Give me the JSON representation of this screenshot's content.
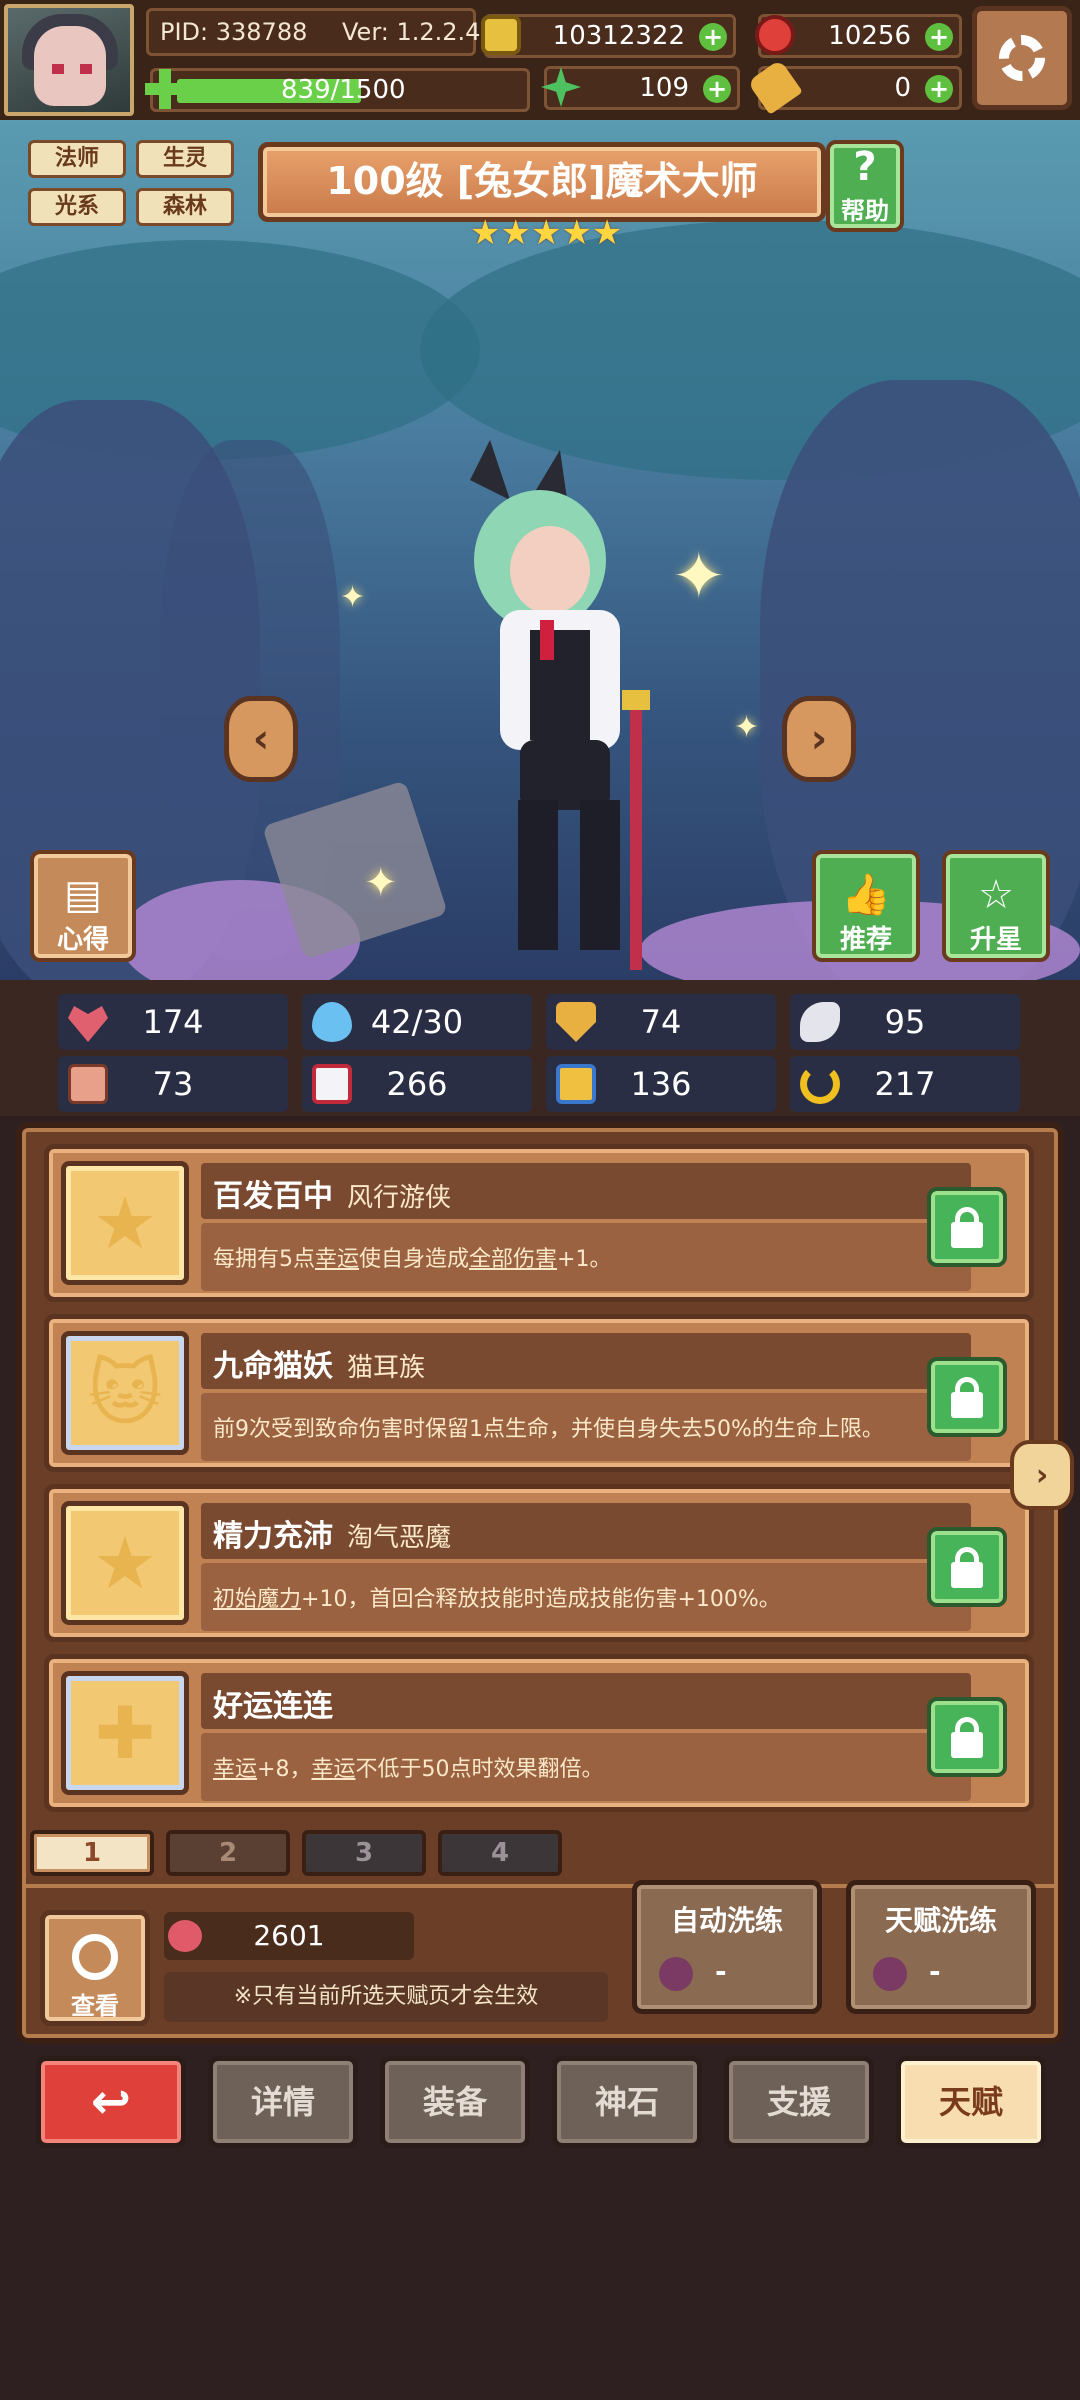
{
  "header": {
    "pid": "PID: 338788",
    "version": "Ver: 1.2.2.4",
    "gold": "10312322",
    "gems": "10256",
    "exp_text": "839/1500",
    "exp_fraction": 0.559,
    "clover": "109",
    "key": "0",
    "settings_icon": "gear-icon"
  },
  "tags": [
    "法师",
    "生灵",
    "光系",
    "森林"
  ],
  "hero": {
    "title": "100级 [兔女郎]魔术大师",
    "stars": "★★★★★",
    "star_count": 5,
    "help_label": "帮助",
    "notes_label": "心得",
    "recommend_label": "推荐",
    "upgrade_label": "升星"
  },
  "stats": {
    "hp": "174",
    "mana": "42/30",
    "defense": "74",
    "speed": "95",
    "attack": "73",
    "magic": "266",
    "skill": "136",
    "luck": "217"
  },
  "talents": [
    {
      "name": "百发百中",
      "source": "风行游侠",
      "desc_parts": [
        "每拥有5点",
        "幸运",
        "使自身造成",
        "全部伤害",
        "+1。"
      ]
    },
    {
      "name": "九命猫妖",
      "source": "猫耳族",
      "desc": "前9次受到致命伤害时保留1点生命，并使自身失去50%的生命上限。"
    },
    {
      "name": "精力充沛",
      "source": "淘气恶魔",
      "desc_parts": [
        "初始魔力",
        "+10，首回合释放技能时造成技能伤害+100%。"
      ]
    },
    {
      "name": "好运连连",
      "source": "",
      "desc_parts": [
        "幸运",
        "+8，",
        "幸运",
        "不低于50点时效果翻倍。"
      ]
    }
  ],
  "pages": [
    "1",
    "2",
    "3",
    "4"
  ],
  "bottom": {
    "lookup_label": "查看",
    "points": "2601",
    "hint": "※只有当前所选天赋页才会生效",
    "auto_wash_label": "自动洗练",
    "auto_wash_cost": "-",
    "talent_wash_label": "天赋洗练",
    "talent_wash_cost": "-"
  },
  "nav": {
    "back": "↩",
    "details": "详情",
    "equipment": "装备",
    "stone": "神石",
    "support": "支援",
    "talent": "天赋"
  },
  "colors": {
    "accent_gold": "#ffd640",
    "lock_green": "#48b45a",
    "back_red": "#e0403a"
  }
}
